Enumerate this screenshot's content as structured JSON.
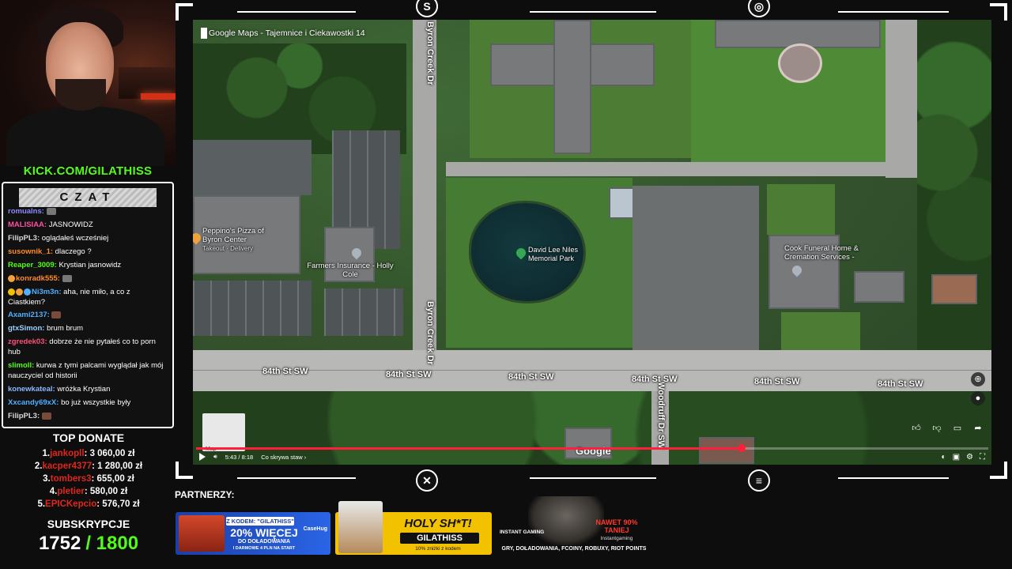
{
  "stream": {
    "kick_url": "KICK.COM/GILATHISS"
  },
  "chat": {
    "title": "CZAT",
    "messages": [
      {
        "user": "romualns:",
        "text": "",
        "color": "#8a8aff"
      },
      {
        "user": "MALISIAA:",
        "text": "JASNOWIDZ",
        "color": "#ff4fa0"
      },
      {
        "user": "FilipPL3:",
        "text": "oglądałeś wcześniej",
        "color": "#d9d9d9"
      },
      {
        "user": "susownik_1:",
        "text": "dlaczego ?",
        "color": "#ff8a2a"
      },
      {
        "user": "Reaper_3009:",
        "text": "Krystian jasnowidz",
        "color": "#53fc18"
      },
      {
        "user": "konradk555:",
        "text": "",
        "color": "#ff8a2a"
      },
      {
        "user": "Ni3m3n:",
        "text": "aha, nie miło, a co z Ciastkiem?",
        "color": "#4fb0ff"
      },
      {
        "user": "Axami2137:",
        "text": "",
        "color": "#4fb0ff"
      },
      {
        "user": "gtxSimon:",
        "text": "brum brum",
        "color": "#9ad0ff"
      },
      {
        "user": "zgredek03:",
        "text": "dobrze że nie pytałeś co to porn hub",
        "color": "#ff4f7a"
      },
      {
        "user": "slimoll:",
        "text": "kurwa z tymi palcami wyglądał jak mój nauczyciel od historii",
        "color": "#53fc18"
      },
      {
        "user": "konewkateal:",
        "text": "wróżka Krystian",
        "color": "#8ab8ff"
      },
      {
        "user": "Xxcandy69xX:",
        "text": "bo już wszystkie były",
        "color": "#4fb0ff"
      },
      {
        "user": "FilipPL3:",
        "text": "",
        "color": "#d9d9d9"
      }
    ]
  },
  "top_donate": {
    "title": "TOP DONATE",
    "items": [
      {
        "rank": "1.",
        "name": "jankopll",
        "amount": ": 3 060,00 zł"
      },
      {
        "rank": "2.",
        "name": "kacper4377",
        "amount": ": 1 280,00 zł"
      },
      {
        "rank": "3.",
        "name": "tombers3",
        "amount": ": 655,00 zł"
      },
      {
        "rank": "4.",
        "name": "pletier",
        "amount": ": 580,00 zł"
      },
      {
        "rank": "5.",
        "name": "EPICKepcio",
        "amount": ": 576,70 zł"
      }
    ]
  },
  "subs": {
    "title": "SUBSKRYPCJE",
    "current": "1752",
    "goal": "/ 1800"
  },
  "video": {
    "title": "Google Maps - Tajemnice i Ciekawostki 14",
    "time": "5:43 / 8:18",
    "chapter": "Co skrywa staw ›",
    "progress": 0.689,
    "google_label": "Google",
    "thumb_label": "Map",
    "accent_color": "#ff1f3a"
  },
  "map": {
    "roads": {
      "byron_top": "Byron Creek Dr",
      "byron_bottom": "Byron Creek Dr",
      "woodruff": "Woodruff Dr SW",
      "street_84": [
        "84th St SW",
        "84th St SW",
        "84th St SW",
        "84th St SW",
        "84th St SW",
        "84th St SW"
      ]
    },
    "pois": {
      "peppinos": "Peppino's Pizza of Byron Center",
      "peppinos_sub": "Takeout · Delivery",
      "farmers": "Farmers Insurance - Holly Cole",
      "park": "David Lee Niles Memorial Park",
      "funeral": "Cook Funeral Home & Cremation Services -"
    }
  },
  "partners": {
    "label": "PARTNERZY:",
    "case": {
      "code": "Z KODEM: \"GILATHISS\"",
      "big": "20% WIĘCEJ",
      "small": "DO DOŁADOWANIA",
      "small2": "I DARMOWE 4 PLN NA START",
      "brand": "CaseHug"
    },
    "holy": {
      "t1": "HOLY SH*T!",
      "t2": "GILATHISS",
      "t3": "10% zniżki z kodem"
    },
    "ig": {
      "logo": "INSTANT GAMING",
      "promo1": "NAWET 90% TANIEJ",
      "promo2": "Instantgaming",
      "bottom": "GRY, DOŁADOWANIA, FCOINY, ROBUXY, RIOT POINTS"
    }
  }
}
